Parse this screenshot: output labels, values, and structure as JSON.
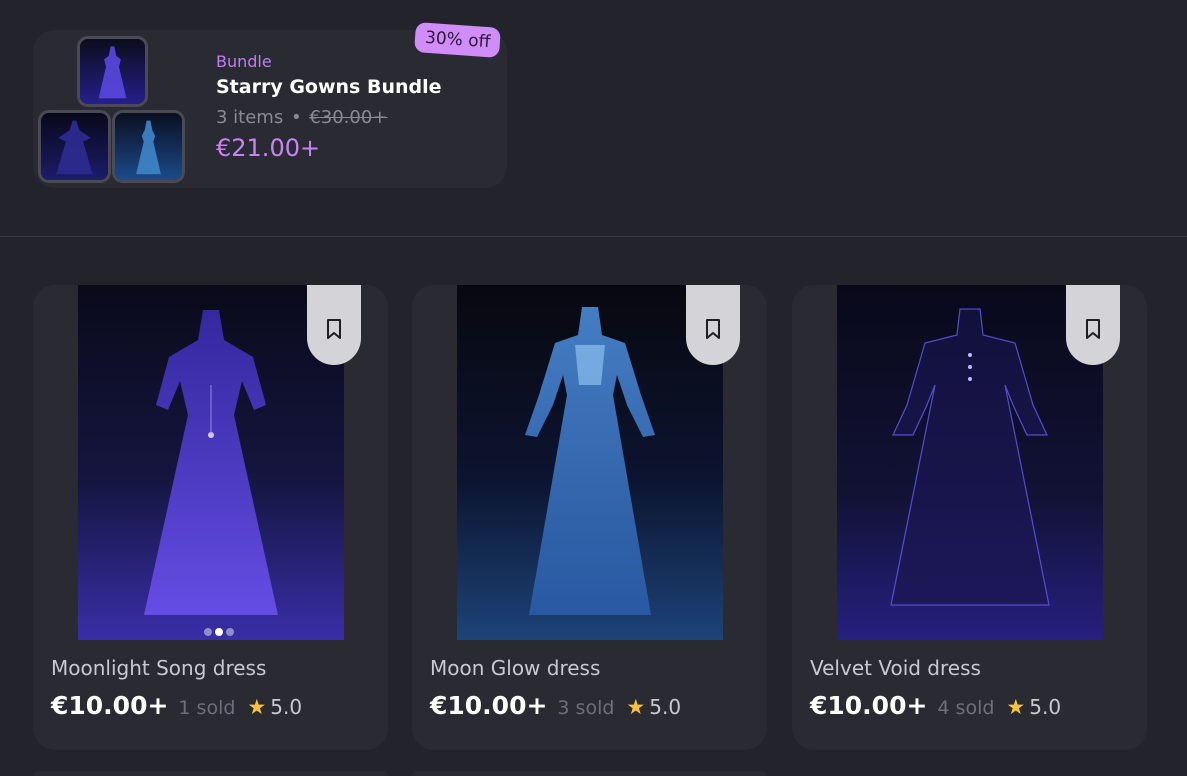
{
  "bundle": {
    "label": "Bundle",
    "title": "Starry Gowns Bundle",
    "items_count": "3 items",
    "separator": "•",
    "original_price": "€30.00+",
    "price": "€21.00+",
    "discount": "30% off"
  },
  "products": [
    {
      "title": "Moonlight Song dress",
      "price": "€10.00+",
      "sold": "1 sold",
      "rating": "5.0",
      "star_icon": "star-icon",
      "bookmark_icon": "bookmark-icon",
      "accent": "#5b46d8"
    },
    {
      "title": "Moon Glow dress",
      "price": "€10.00+",
      "sold": "3 sold",
      "rating": "5.0",
      "star_icon": "star-icon",
      "bookmark_icon": "bookmark-icon",
      "accent": "#3b6fc7"
    },
    {
      "title": "Velvet Void dress",
      "price": "€10.00+",
      "sold": "4 sold",
      "rating": "5.0",
      "star_icon": "star-icon",
      "bookmark_icon": "bookmark-icon",
      "accent": "#3a2fa8"
    }
  ],
  "colors": {
    "background": "#23232b",
    "card": "#2a2a33",
    "accent_purple": "#c884f6",
    "star": "#f6c33a"
  }
}
